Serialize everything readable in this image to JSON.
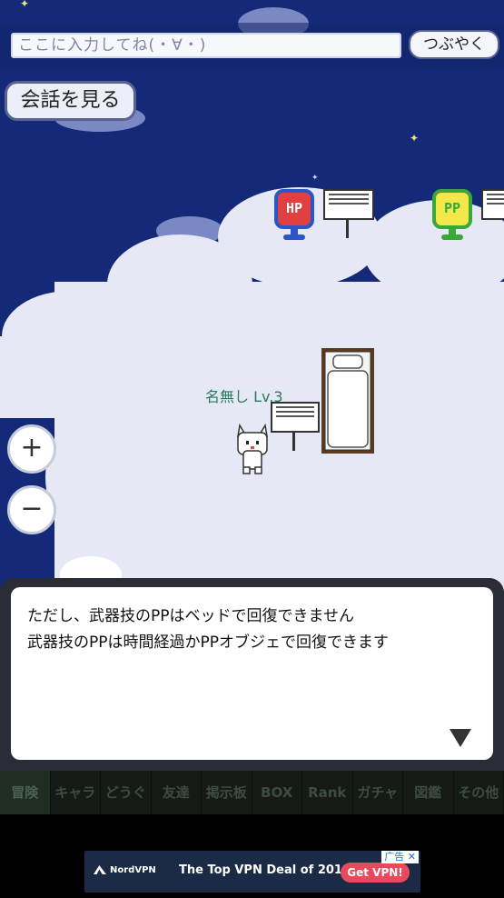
{
  "chat": {
    "placeholder": "ここに入力してね(・∀・)",
    "tweet_label": "つぶやく"
  },
  "view_convo_label": "会話を見る",
  "signs": {
    "hp_label": "HP",
    "pp_label": "PP"
  },
  "player": {
    "name_level": "名無し Lv.3"
  },
  "zoom": {
    "in_label": "+",
    "out_label": "−"
  },
  "dialog": {
    "line1": "ただし、武器技のPPはベッドで回復できません",
    "line2": "武器技のPPは時間経過かPPオブジェで回復できます"
  },
  "menu": {
    "items": [
      "冒険",
      "キャラ",
      "どうぐ",
      "友達",
      "掲示板",
      "BOX",
      "Rank",
      "ガチャ",
      "図鑑",
      "その他"
    ]
  },
  "ad": {
    "brand": "NordVPN",
    "headline": "The Top VPN Deal of 2018",
    "cta": "Get VPN!",
    "label": "广告 ✕"
  },
  "colors": {
    "sky": "#142a78",
    "cloud": "#e6e8f5",
    "hp_blue": "#2a56c8",
    "hp_red": "#e04040",
    "pp_green": "#3aa838",
    "pp_yellow": "#f2e84a",
    "ad_button": "#e64a5c"
  }
}
